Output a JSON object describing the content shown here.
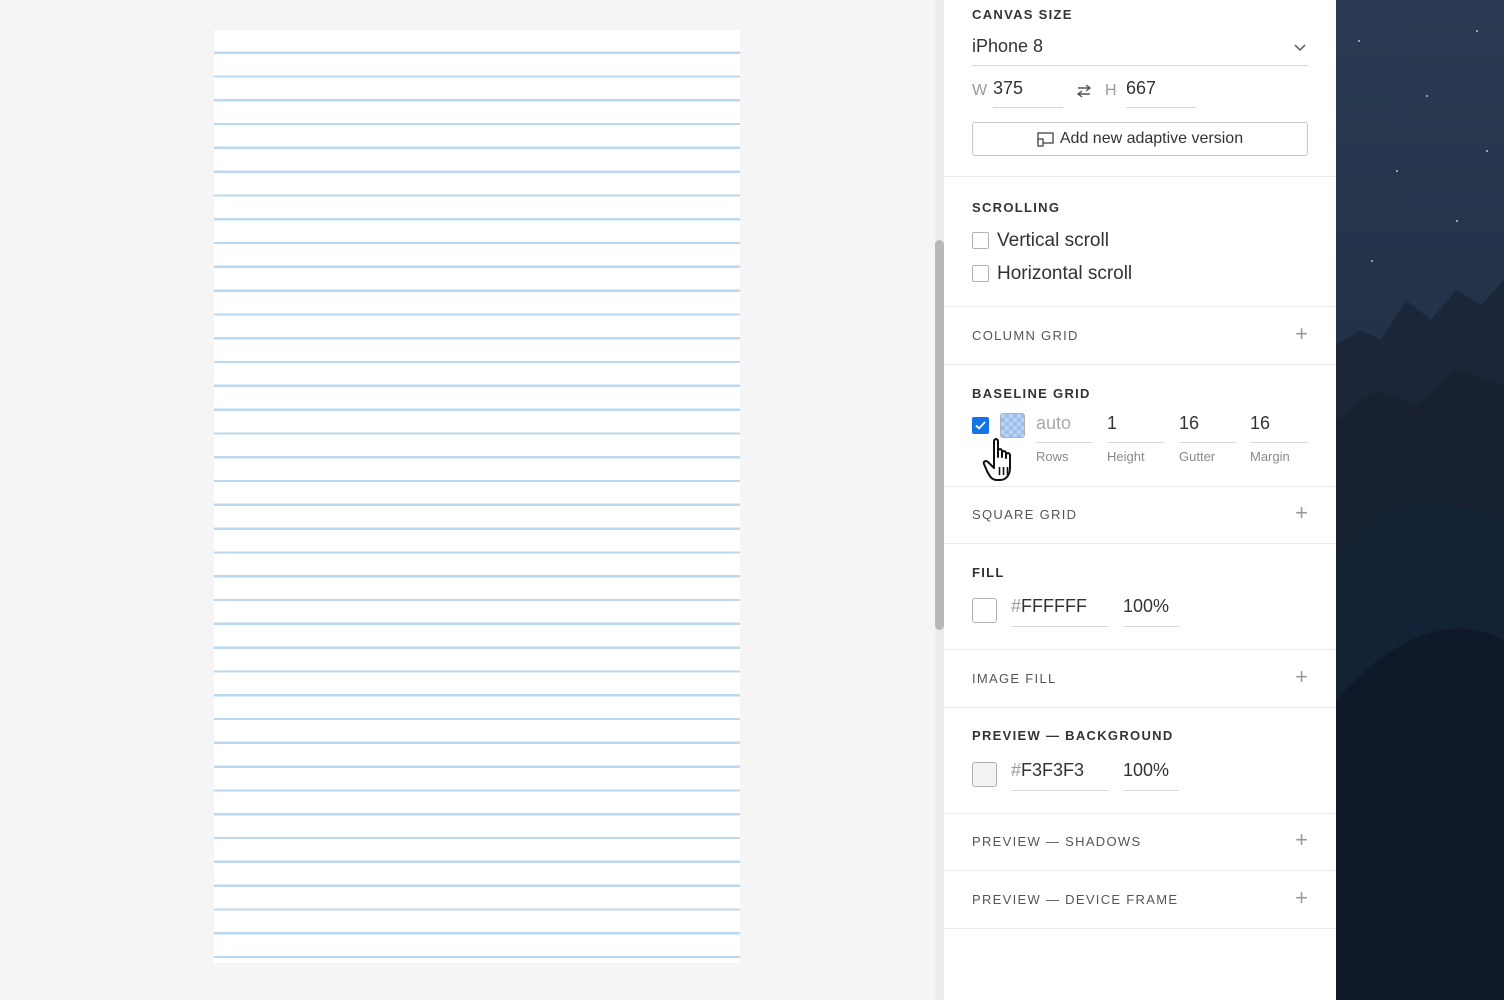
{
  "canvas_size": {
    "title": "CANVAS SIZE",
    "device": "iPhone 8",
    "w_label": "W",
    "w_value": "375",
    "h_label": "H",
    "h_value": "667",
    "adaptive_button": "Add new adaptive version"
  },
  "scrolling": {
    "title": "SCROLLING",
    "vertical": "Vertical scroll",
    "horizontal": "Horizontal scroll"
  },
  "column_grid": {
    "title": "COLUMN GRID"
  },
  "baseline_grid": {
    "title": "BASELINE GRID",
    "rows_placeholder": "auto",
    "rows_label": "Rows",
    "height_value": "1",
    "height_label": "Height",
    "gutter_value": "16",
    "gutter_label": "Gutter",
    "margin_value": "16",
    "margin_label": "Margin",
    "enabled": true
  },
  "square_grid": {
    "title": "SQUARE GRID"
  },
  "fill": {
    "title": "FILL",
    "hash": "#",
    "hex": "FFFFFF",
    "opacity": "100%",
    "color": "#FFFFFF"
  },
  "image_fill": {
    "title": "IMAGE FILL"
  },
  "preview_background": {
    "title": "PREVIEW — BACKGROUND",
    "hash": "#",
    "hex": "F3F3F3",
    "opacity": "100%",
    "color": "#F3F3F3"
  },
  "preview_shadows": {
    "title": "PREVIEW — SHADOWS"
  },
  "preview_device_frame": {
    "title": "PREVIEW — DEVICE FRAME"
  },
  "colors": {
    "accent": "#1473e6",
    "grid_line": "#bcd8f0"
  },
  "icons": [
    "chevron-down-icon",
    "swap-icon",
    "adaptive-icon",
    "plus-icon",
    "check-icon",
    "hand-cursor-icon"
  ]
}
